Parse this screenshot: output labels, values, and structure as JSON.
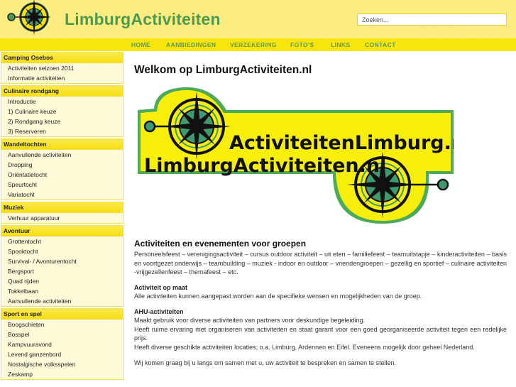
{
  "header": {
    "site_title": "LimburgActiviteiten",
    "logo_icon": "compass-icon",
    "search": {
      "placeholder": "Zoeken..."
    }
  },
  "nav": {
    "items": [
      {
        "label": "HOME"
      },
      {
        "label": "AANBIEDINGEN"
      },
      {
        "label": "VERZEKERING"
      },
      {
        "label": "FOTO'S"
      },
      {
        "label": "LINKS"
      },
      {
        "label": "CONTACT"
      }
    ]
  },
  "sidebar": {
    "categories": [
      {
        "title": "Camping Osebos",
        "items": [
          "Activiteiten seizoen 2011",
          "Informatie activiteiten"
        ]
      },
      {
        "title": "Culinaire rondgang",
        "items": [
          "Introductie",
          "1) Culinaire keuze",
          "2) Rondgang keuze",
          "3) Reserveren"
        ]
      },
      {
        "title": "Wandeltochten",
        "items": [
          "Aanvullende activiteiten",
          "Dropping",
          "Oriëntatietocht",
          "Speurtocht",
          "Variatocht"
        ]
      },
      {
        "title": "Muziek",
        "items": [
          "Verhuur apparatuur"
        ]
      },
      {
        "title": "Avontuur",
        "items": [
          "Grottentocht",
          "Spooktocht",
          "Survival- / Avonturentocht",
          "Bergsport",
          "Quad rijden",
          "Tokkelbaan",
          "Aanvullende activiteiten"
        ]
      },
      {
        "title": "Sport en spel",
        "items": [
          "Boogschieten",
          "Bosspel",
          "Kampvuuravond",
          "Levend ganzenbord",
          "Nostalgische volksspelen",
          "Zeskamp"
        ]
      }
    ]
  },
  "main": {
    "title": "Welkom op LimburgActiviteiten.nl",
    "banner": {
      "line1": "ActiviteitenLimburg.nl",
      "line2": "LimburgActiviteiten.nl"
    },
    "section_title": "Activiteiten en evenementen voor groepen",
    "intro": "Personeelsfeest – verenigingsactiviteit – cursus outdoor activiteit – uit eten – familiefeest – teamuitstapje – kinderactiviteiten – basis en voortgezet onderwijs – teambuilding – muziek - indoor en outdoor – vriendengroepen – gezellig en sportief – culinaire activiteiten -vrijgezellenfeest – themafeest – etc.",
    "blocks": [
      {
        "title": "Activiteit op maat",
        "lines": [
          "Alle activiteiten kunnen aangepast worden aan de specifieke wensen en mogelijkheden van de groep."
        ]
      },
      {
        "title": "AHU-activiteiten",
        "lines": [
          "Maakt gebruik voor diverse activiteiten van partners voor deskundige begeleiding.",
          "Heeft ruime ervaring met organiseren van activiteiten en staat garant voor een goed georganiseerde activiteit tegen een redelijke prijs.",
          "Heeft diverse geschikte activiteiten locaties; o.a. Limburg, Ardennen en Eifel. Eveneens mogelijk door geheel Nederland."
        ]
      }
    ],
    "closing": "Wij komen graag bij u langs om samen met u, uw activiteit te bespreken en samen te stellen."
  },
  "colors": {
    "header_bg": "#fdeb7a",
    "nav_bg": "#f8e50e",
    "brand_green": "#4c9a4f",
    "sidebar_bg": "#fffbd8"
  }
}
